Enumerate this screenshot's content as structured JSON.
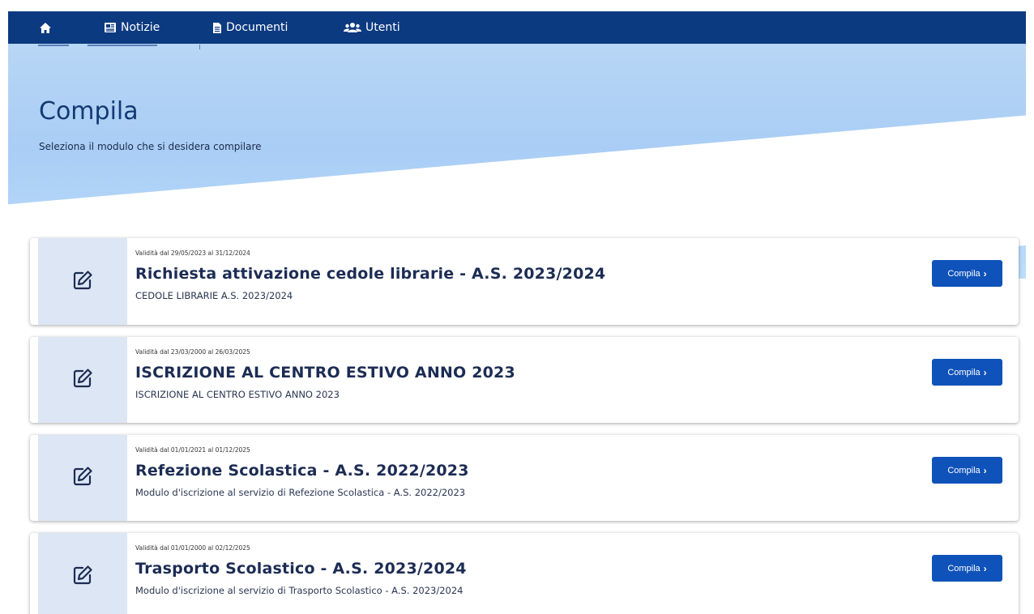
{
  "nav": {
    "items": [
      {
        "label": "",
        "icon": "home-icon"
      },
      {
        "label": "Notizie",
        "icon": "newspaper-icon"
      },
      {
        "label": "Documenti",
        "icon": "document-icon"
      },
      {
        "label": "Utenti",
        "icon": "users-icon"
      }
    ]
  },
  "hero": {
    "title": "Compila",
    "subtitle": "Seleziona il modulo che si desidera compilare"
  },
  "cards": [
    {
      "validity": "Validità dal 29/05/2023 al 31/12/2024",
      "title": "Richiesta attivazione cedole librarie - A.S. 2023/2024",
      "description": "CEDOLE LIBRARIE A.S. 2023/2024",
      "button": "Compila",
      "icon": "edit-icon"
    },
    {
      "validity": "Validità dal 23/03/2000 al 26/03/2025",
      "title": "ISCRIZIONE AL CENTRO ESTIVO ANNO 2023",
      "description": "ISCRIZIONE AL CENTRO ESTIVO ANNO 2023",
      "button": "Compila",
      "icon": "edit-icon"
    },
    {
      "validity": "Validità dal 01/01/2021 al 01/12/2025",
      "title": "Refezione Scolastica - A.S. 2022/2023",
      "description": "Modulo d'iscrizione al servizio di Refezione Scolastica - A.S. 2022/2023",
      "button": "Compila",
      "icon": "edit-icon"
    },
    {
      "validity": "Validità dal 01/01/2000 al 02/12/2025",
      "title": "Trasporto Scolastico - A.S. 2023/2024",
      "description": "Modulo d'iscrizione al servizio di Trasporto Scolastico - A.S. 2023/2024",
      "button": "Compila",
      "icon": "edit-icon"
    }
  ],
  "colors": {
    "navbar": "#0c3a80",
    "button": "#0f52ba",
    "hero": "#b8d6f5",
    "card_left": "#dde6f4"
  }
}
